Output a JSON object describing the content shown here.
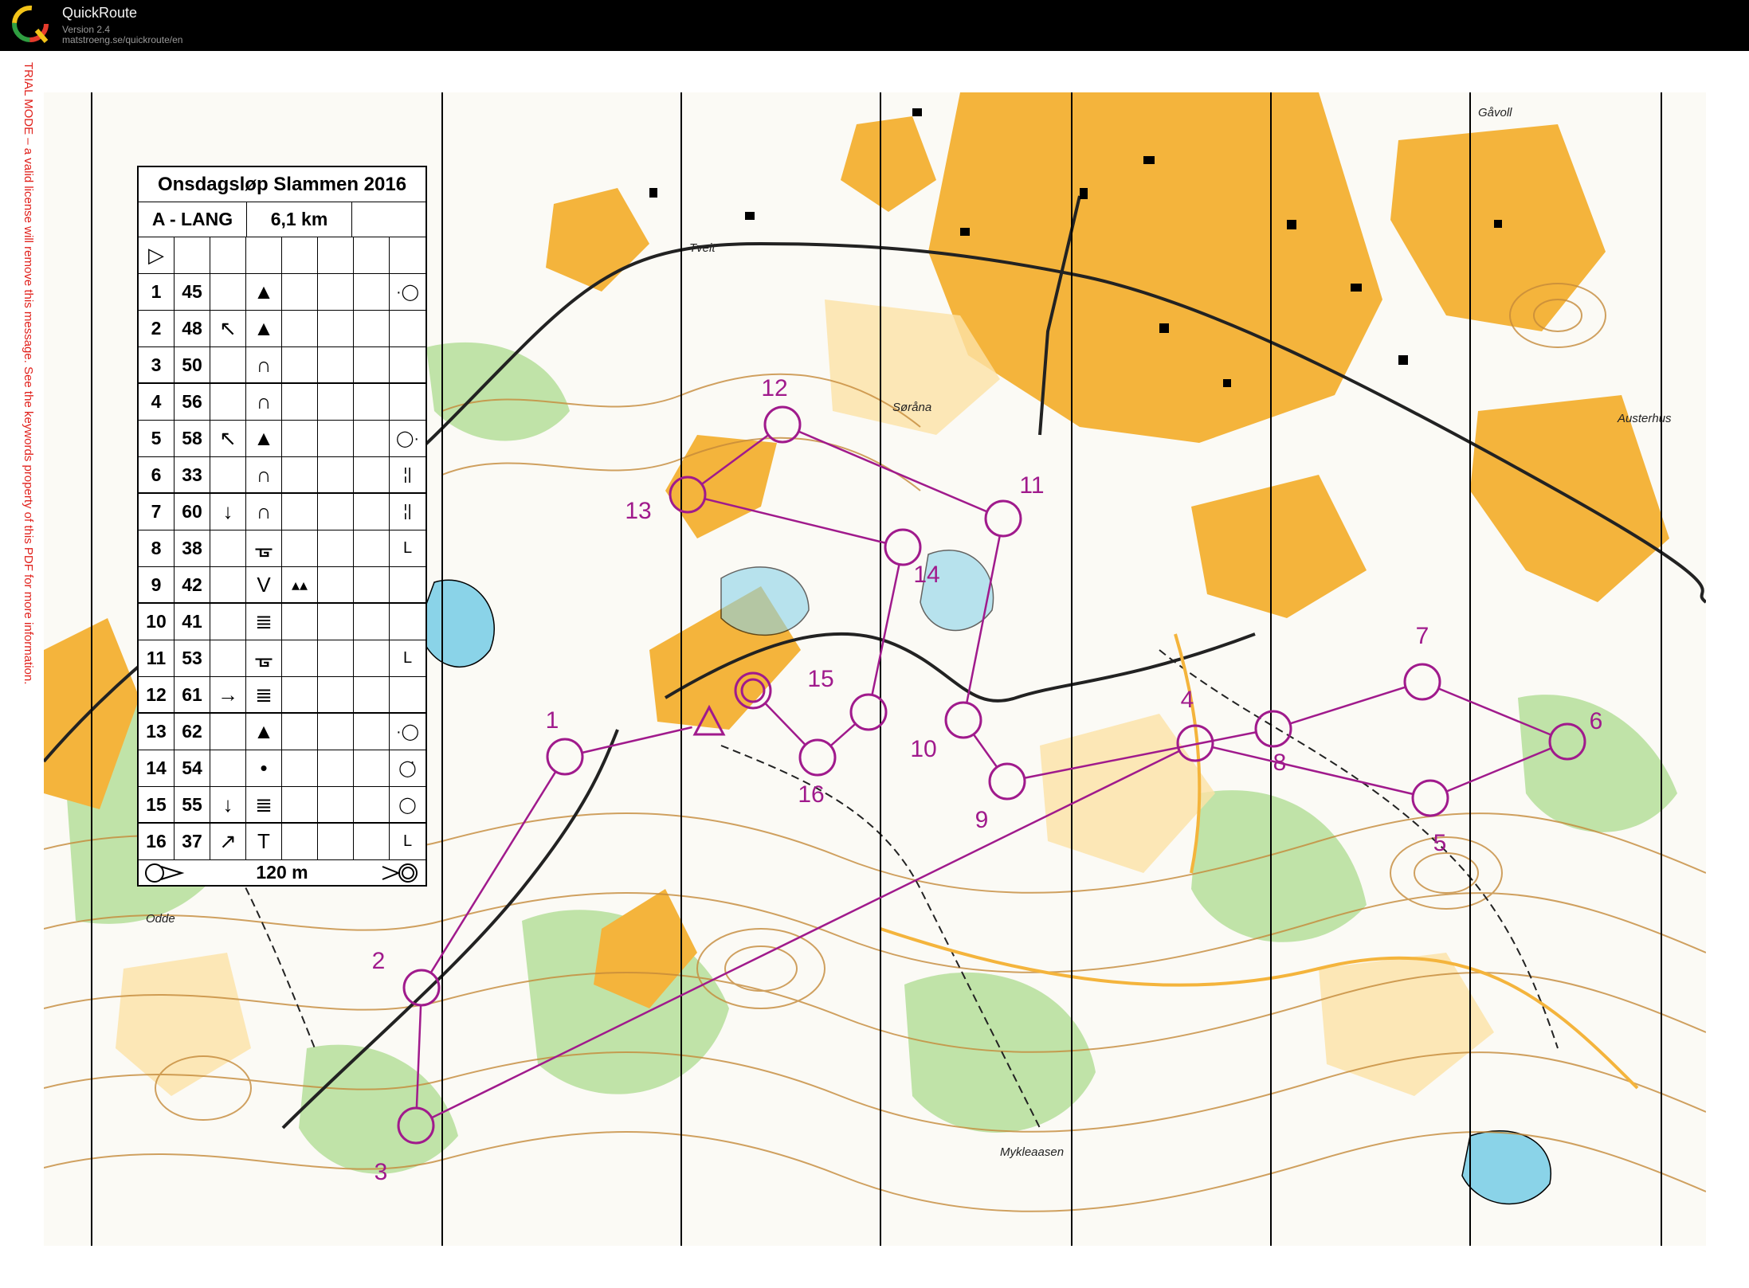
{
  "app": {
    "name": "QuickRoute",
    "version": "Version 2.4",
    "url": "matstroeng.se/quickroute/en",
    "trial_message": "TRIAL MODE – a valid license will remove this message. See the keywords property of this PDF for more information."
  },
  "colors": {
    "titlebar": "#000000",
    "course": "#a01a8c",
    "trial_text": "#e0201b",
    "open_land": "#f4b43c",
    "forest_green": "#a8d88a",
    "contour": "#c58a3a",
    "water": "#8ad3e8"
  },
  "map": {
    "place_names": [
      "Tveit",
      "Søråna",
      "Gåvoll",
      "Austerhus",
      "Odde",
      "Mykleaasen"
    ],
    "controls": [
      {
        "label": "1"
      },
      {
        "label": "2"
      },
      {
        "label": "3"
      },
      {
        "label": "4"
      },
      {
        "label": "5"
      },
      {
        "label": "6"
      },
      {
        "label": "7"
      },
      {
        "label": "8"
      },
      {
        "label": "9"
      },
      {
        "label": "10"
      },
      {
        "label": "11"
      },
      {
        "label": "12"
      },
      {
        "label": "13"
      },
      {
        "label": "14"
      },
      {
        "label": "15"
      },
      {
        "label": "16"
      }
    ]
  },
  "card": {
    "title": "Onsdagsløp Slammen 2016",
    "course": "A - LANG",
    "length": "6,1 km",
    "start_symbol": "▷",
    "finish_distance": "120 m",
    "rows": [
      {
        "num": "1",
        "code": "45",
        "dir": "",
        "feature": "▲",
        "extra": "",
        "pos": "·◯"
      },
      {
        "num": "2",
        "code": "48",
        "dir": "↖",
        "feature": "▲",
        "extra": "",
        "pos": ""
      },
      {
        "num": "3",
        "code": "50",
        "dir": "",
        "feature": "∩",
        "extra": "",
        "pos": ""
      },
      {
        "num": "4",
        "code": "56",
        "dir": "",
        "feature": "∩",
        "extra": "",
        "pos": ""
      },
      {
        "num": "5",
        "code": "58",
        "dir": "↖",
        "feature": "▲",
        "extra": "",
        "pos": "◯·"
      },
      {
        "num": "6",
        "code": "33",
        "dir": "",
        "feature": "∩",
        "extra": "",
        "pos": "¦|"
      },
      {
        "num": "7",
        "code": "60",
        "dir": "↓",
        "feature": "∩",
        "extra": "",
        "pos": "¦|"
      },
      {
        "num": "8",
        "code": "38",
        "dir": "",
        "feature": "ᚗ",
        "extra": "",
        "pos": "L"
      },
      {
        "num": "9",
        "code": "42",
        "dir": "",
        "feature": "V",
        "extra": "▴▴",
        "pos": ""
      },
      {
        "num": "10",
        "code": "41",
        "dir": "",
        "feature": "≣",
        "extra": "",
        "pos": ""
      },
      {
        "num": "11",
        "code": "53",
        "dir": "",
        "feature": "ᚗ",
        "extra": "",
        "pos": "L"
      },
      {
        "num": "12",
        "code": "61",
        "dir": "→",
        "feature": "≣",
        "extra": "",
        "pos": ""
      },
      {
        "num": "13",
        "code": "62",
        "dir": "",
        "feature": "▲",
        "extra": "",
        "pos": "·◯"
      },
      {
        "num": "14",
        "code": "54",
        "dir": "",
        "feature": "•",
        "extra": "",
        "pos": "◯̇"
      },
      {
        "num": "15",
        "code": "55",
        "dir": "↓",
        "feature": "≣",
        "extra": "",
        "pos": "◯"
      },
      {
        "num": "16",
        "code": "37",
        "dir": "↗",
        "feature": "T",
        "extra": "",
        "pos": "L"
      }
    ]
  }
}
